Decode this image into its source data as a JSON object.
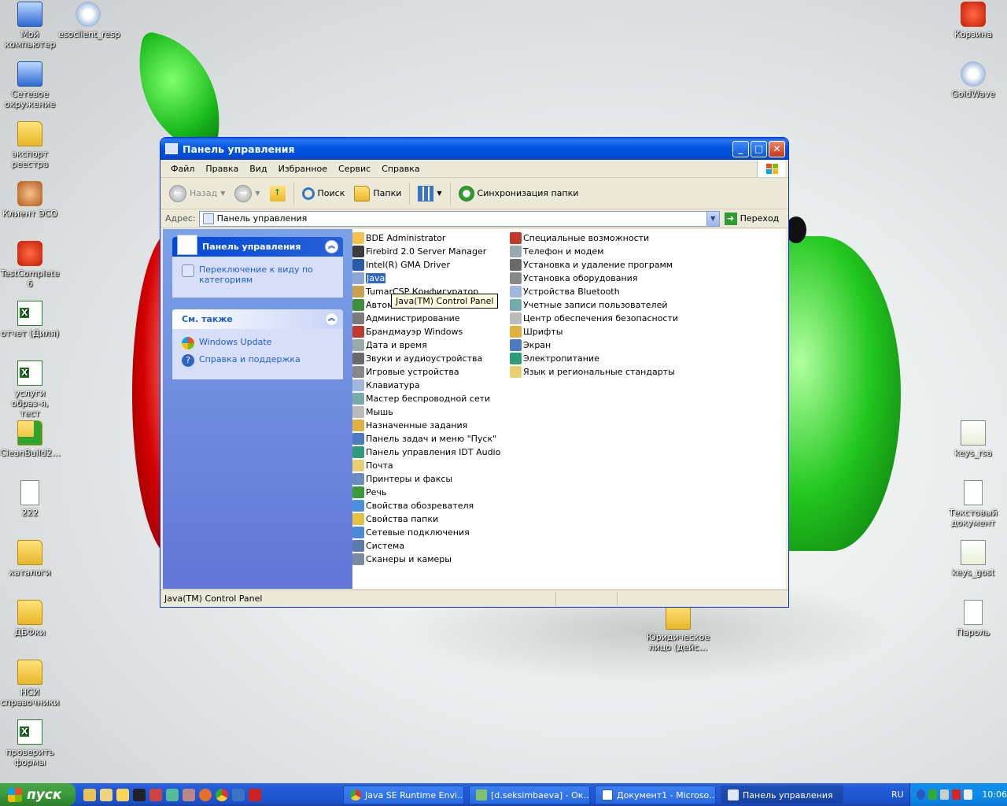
{
  "desktop_icons_left": [
    {
      "label": "Мой компьютер",
      "icon": "my-computer-icon"
    },
    {
      "label": "esoclient_resp",
      "icon": "installer-disc-icon"
    },
    {
      "label": "Сетевое окружение",
      "icon": "network-places-icon"
    },
    {
      "label": "экспорт реестра",
      "icon": "folder-icon"
    },
    {
      "label": "Клиент ЭСО",
      "icon": "eso-client-icon"
    },
    {
      "label": "TestComplete 6",
      "icon": "testcomplete-icon"
    },
    {
      "label": "отчет (Диля)",
      "icon": "excel-file-icon"
    },
    {
      "label": "услуги образ-я, тест",
      "icon": "excel-file-icon"
    },
    {
      "label": "CleanBuild2…",
      "icon": "folder-check-icon"
    },
    {
      "label": "222",
      "icon": "text-file-icon"
    },
    {
      "label": "каталоги",
      "icon": "folder-icon"
    },
    {
      "label": "ДБФки",
      "icon": "folder-icon"
    },
    {
      "label": "НСИ справочники",
      "icon": "folder-icon"
    },
    {
      "label": "проверить формы",
      "icon": "excel-file-icon"
    }
  ],
  "desktop_icons_right": [
    {
      "label": "Корзина",
      "icon": "recycle-bin-icon"
    },
    {
      "label": "GoldWave",
      "icon": "goldwave-icon"
    },
    {
      "label": "keys_rsa",
      "icon": "certificate-icon"
    },
    {
      "label": "Текстовый документ",
      "icon": "text-file-icon"
    },
    {
      "label": "keys_gost",
      "icon": "certificate-icon"
    },
    {
      "label": "Пароль",
      "icon": "text-file-icon"
    },
    {
      "label": "Юридическое лицо (дейс…",
      "icon": "folder-icon"
    }
  ],
  "window": {
    "title": "Панель управления",
    "menu": [
      "Файл",
      "Правка",
      "Вид",
      "Избранное",
      "Сервис",
      "Справка"
    ],
    "toolbar": {
      "back": "Назад",
      "search": "Поиск",
      "folders": "Папки",
      "sync": "Синхронизация папки"
    },
    "address": {
      "label": "Адрес:",
      "value": "Панель управления",
      "go": "Переход"
    },
    "sidebar": {
      "panel1_title": "Панель управления",
      "switch_view": "Переключение к виду по категориям",
      "panel2_title": "См. также",
      "links": [
        "Windows Update",
        "Справка и поддержка"
      ]
    },
    "items_col1": [
      "BDE Administrator",
      "Firebird 2.0 Server Manager",
      "Intel(R) GMA Driver",
      "Java",
      "TumarCSP Конфигуратор",
      "Автом",
      "Администрирование",
      "Брандмауэр Windows",
      "Дата и время",
      "Звуки и аудиоустройства",
      "Игровые устройства",
      "Клавиатура",
      "Мастер беспроводной сети",
      "Мышь",
      "Назначенные задания",
      "Панель задач и меню \"Пуск\"",
      "Панель управления IDT Audio",
      "Почта",
      "Принтеры и факсы",
      "Речь",
      "Свойства обозревателя",
      "Свойства папки",
      "Сетевые подключения",
      "Система",
      "Сканеры и камеры"
    ],
    "items_col2": [
      "Специальные возможности",
      "Телефон и модем",
      "Установка и удаление программ",
      "Установка оборудования",
      "Устройства Bluetooth",
      "Учетные записи пользователей",
      "Центр обеспечения безопасности",
      "Шрифты",
      "Экран",
      "Электропитание",
      "Язык и региональные стандарты"
    ],
    "selected_item": "Java",
    "tooltip": "Java(TM) Control Panel",
    "status": "Java(TM) Control Panel"
  },
  "taskbar": {
    "start": "пуск",
    "tasks": [
      {
        "label": "Java SE Runtime Envi…",
        "icon": "chrome-icon"
      },
      {
        "label": "[d.seksimbaeva] - Ок…",
        "icon": "mail-client-icon"
      },
      {
        "label": "Документ1 - Microso…",
        "icon": "word-icon"
      },
      {
        "label": "Панель управления",
        "icon": "control-panel-icon",
        "active": true
      }
    ],
    "lang": "RU",
    "clock": "10:06"
  }
}
